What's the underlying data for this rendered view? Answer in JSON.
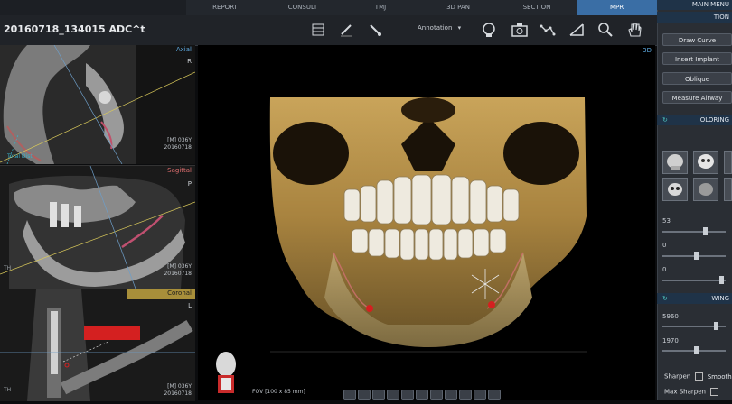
{
  "tabs": [
    "REPORT",
    "CONSULT",
    "TMJ",
    "3D PAN",
    "SECTION",
    "MPR"
  ],
  "active_tab": "MPR",
  "patient_title": "20160718_134015 ADC^t",
  "toolbar": {
    "annotation_label": "Annotation"
  },
  "viewports": {
    "axial": {
      "label": "Axial",
      "orient": "R",
      "info": [
        "[M] 036Y",
        "20160718"
      ],
      "extra": "Total Dist"
    },
    "sagittal": {
      "label": "Sagittal",
      "orient": "P",
      "info": [
        "[M] 036Y",
        "20160718"
      ],
      "extra": "TH"
    },
    "coronal": {
      "label": "Coronal",
      "orient": "L",
      "info": [
        "[M] 036Y",
        "20160718"
      ],
      "extra": "TH"
    }
  },
  "view3d": {
    "label": "3D",
    "fov": "FOV [100 x 85 mm]"
  },
  "right_panel": {
    "main_menu": "MAIN MENU",
    "section_header": "TION",
    "buttons": [
      "Draw Curve",
      "Insert Implant",
      "Oblique",
      "Measure Airway"
    ],
    "coloring_header": "OLORING",
    "sliders": [
      {
        "value": "53",
        "fill": 0.55
      },
      {
        "value": "0",
        "fill": 0.5
      },
      {
        "value": "0",
        "fill": 0.9
      }
    ],
    "windowing_header": "WING",
    "window_values": [
      "5960",
      "1970"
    ],
    "options": [
      "Sharpen",
      "Max Sharpen"
    ],
    "option_prefix": "Smooth"
  },
  "colors": {
    "accent": "#3a6ea5",
    "panel": "#2a2e34",
    "coronal_label_bg": "#a88f3a",
    "sagittal_label": "#e06f6f",
    "axial_label": "#5da9e0"
  }
}
